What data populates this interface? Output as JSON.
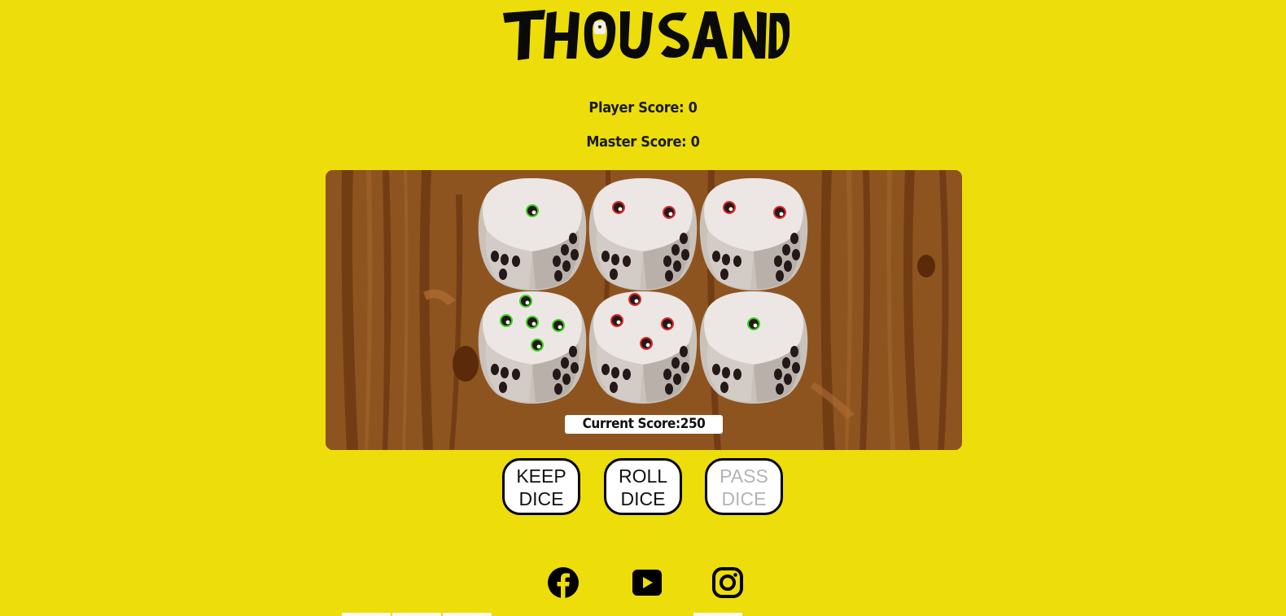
{
  "header": {
    "logo_text": "THOUSAND"
  },
  "scores": {
    "player_label": "Player Score: ",
    "player_value": "0",
    "master_label": "Master Score: ",
    "master_value": "0"
  },
  "board": {
    "current_score_label": "Current Score:",
    "current_score_value": "250",
    "dice": [
      {
        "value": 1,
        "selected": true
      },
      {
        "value": 2,
        "selected": false
      },
      {
        "value": 2,
        "selected": false
      },
      {
        "value": 5,
        "selected": true
      },
      {
        "value": 4,
        "selected": false
      },
      {
        "value": 1,
        "selected": true
      }
    ]
  },
  "controls": {
    "keep": {
      "line1": "KEEP",
      "line2": "DICE",
      "enabled": true
    },
    "roll": {
      "line1": "ROLL",
      "line2": "DICE",
      "enabled": true
    },
    "pass": {
      "line1": "PASS",
      "line2": "DICE",
      "enabled": false
    }
  },
  "footer": {
    "icons": [
      "facebook-icon",
      "youtube-icon",
      "instagram-icon"
    ]
  },
  "colors": {
    "background": "#ecdd0b",
    "board_wood": "#8e5420",
    "selected_pip_ring": "#39d31b",
    "unselected_pip_ring": "#e02828",
    "pip": "#241818"
  }
}
